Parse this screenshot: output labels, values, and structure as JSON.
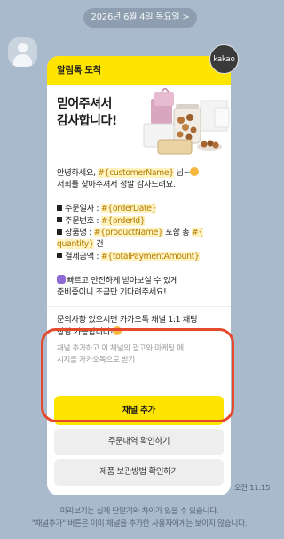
{
  "date_divider": "2026년 6월 4일 목요일 >",
  "sender_badge": "kakao",
  "message": {
    "header": "알림톡 도착",
    "hero_title_line1": "믿어주셔서",
    "hero_title_line2": "감사합니다!",
    "greeting_prefix": "안녕하세요, ",
    "var_customer_name": "#{customerName}",
    "greeting_suffix": " 님~",
    "thanks_line": "저희를 찾아주셔서 정말 감사드려요.",
    "order_date_label": "주문일자 : ",
    "var_order_date": "#{orderDate}",
    "order_id_label": "주문번호 : ",
    "var_order_id": "#{orderId}",
    "product_label": "상품명 : ",
    "var_product_name": "#{productName}",
    "product_middle": " 포함 총 ",
    "var_quantity_a": "#{",
    "var_quantity_b": "quantity}",
    "quantity_suffix": " 건",
    "payment_label": "결제금액 : ",
    "var_total_payment": "#{totalPaymentAmount}",
    "shipping_line1": "빠르고 안전하게 받아보실 수 있게",
    "shipping_line2": "준비중이니 조금만 기다려주세요!",
    "channel_prompt_line1": "문의사항 있으시면 카카오톡 채널 1:1 채팅",
    "channel_prompt_line2": "상담 가능합니다!",
    "consent_note_line1": "채널 추가하고 이 채널의 광고와 마케팅 메",
    "consent_note_line2": "시지를 카카오톡으로 받기",
    "add_channel_button": "채널 추가",
    "order_history_button": "주문내역 확인하기",
    "storage_guide_button": "제품 보관방법 확인하기"
  },
  "timestamp": "오전 11:15",
  "footer_line1": "미리보기는 실제 단말기와 차이가 있을 수 있습니다.",
  "footer_line2": "\"채널추가\" 버튼은 이미 채널을 추가한 사용자에게는 보이지 않습니다.",
  "colors": {
    "background": "#a9bacd",
    "kakao_yellow": "#fee500",
    "highlight_ring": "#e54a2e"
  }
}
